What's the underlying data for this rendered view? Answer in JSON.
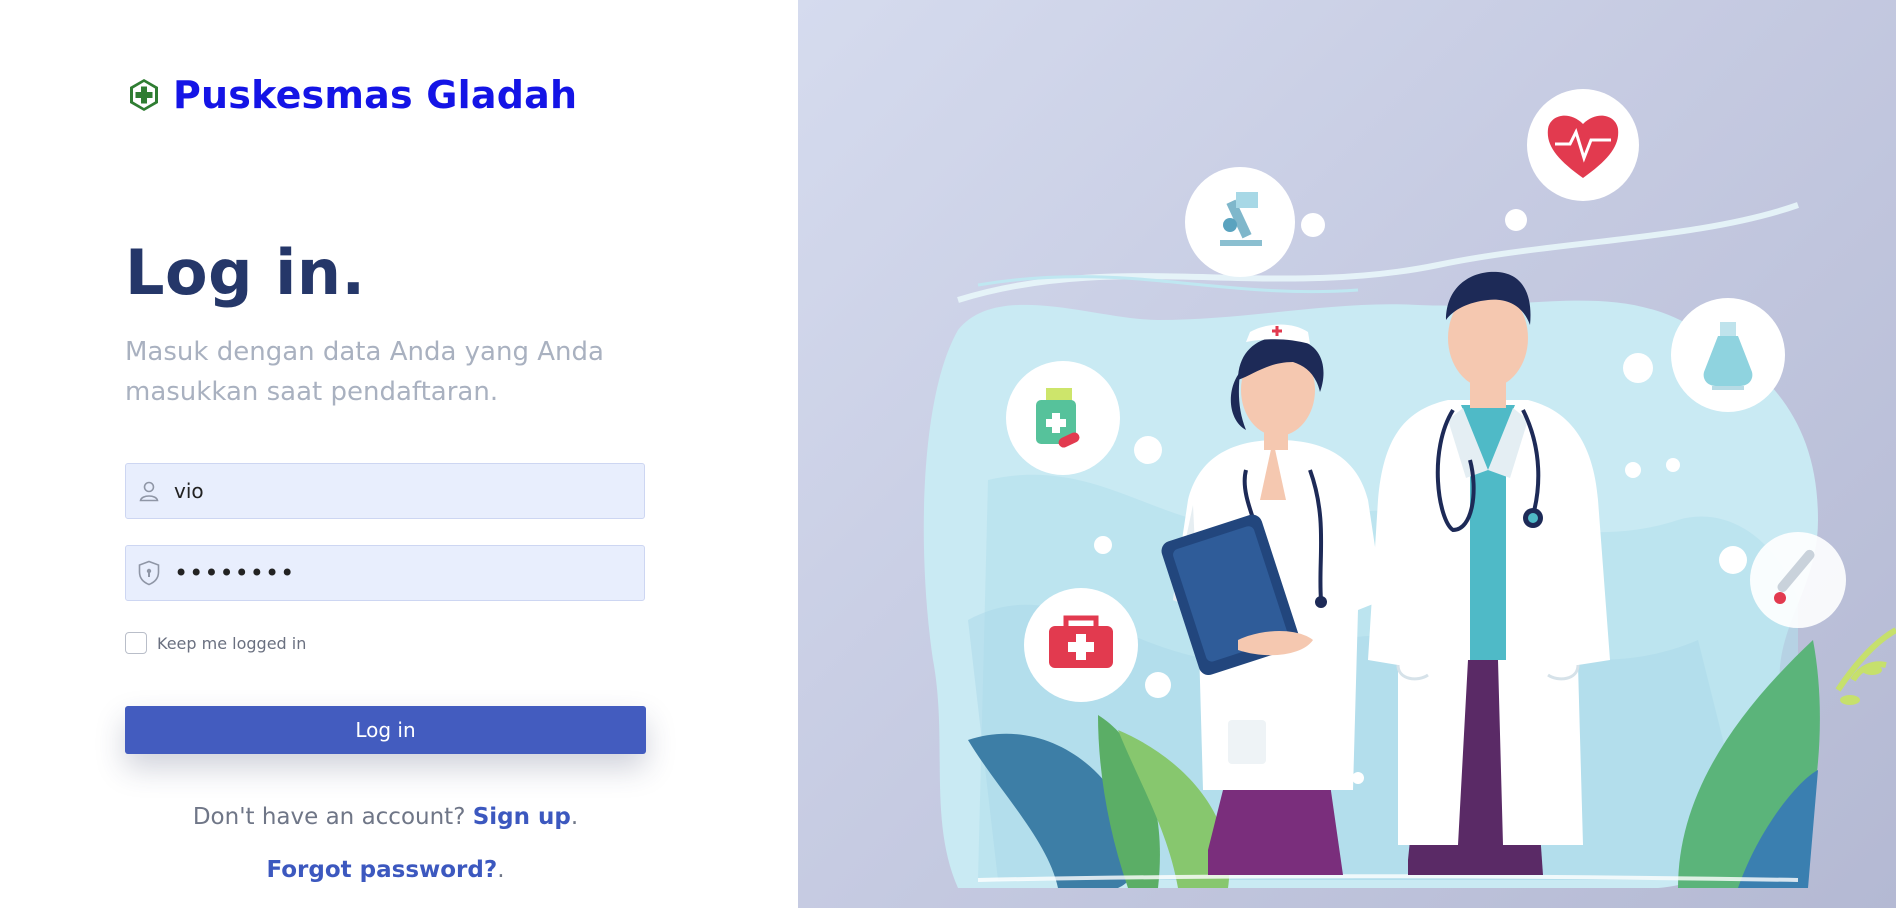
{
  "brand": {
    "name": "Puskesmas Gladah",
    "logo_icon": "health-cross-icon",
    "color": "#1414e6"
  },
  "login": {
    "title": "Log in.",
    "subtitle": "Masuk dengan data Anda yang Anda masukkan saat pendaftaran.",
    "username": {
      "value": "vio",
      "icon": "user-icon"
    },
    "password": {
      "value": "vioxxxxx",
      "icon": "shield-lock-icon"
    },
    "remember_label": "Keep me logged in",
    "remember_checked": false,
    "submit_label": "Log in",
    "signup_prompt": "Don't have an account?",
    "signup_link": "Sign up",
    "period": ".",
    "forgot_link": "Forgot password?"
  },
  "colors": {
    "accent": "#435cbf",
    "title": "#253769",
    "input_bg": "#e8eefd"
  },
  "illustration": {
    "icons": [
      "heart-pulse-icon",
      "microscope-icon",
      "medicine-bottle-icon",
      "flask-icon",
      "first-aid-kit-icon",
      "thermometer-icon"
    ]
  }
}
